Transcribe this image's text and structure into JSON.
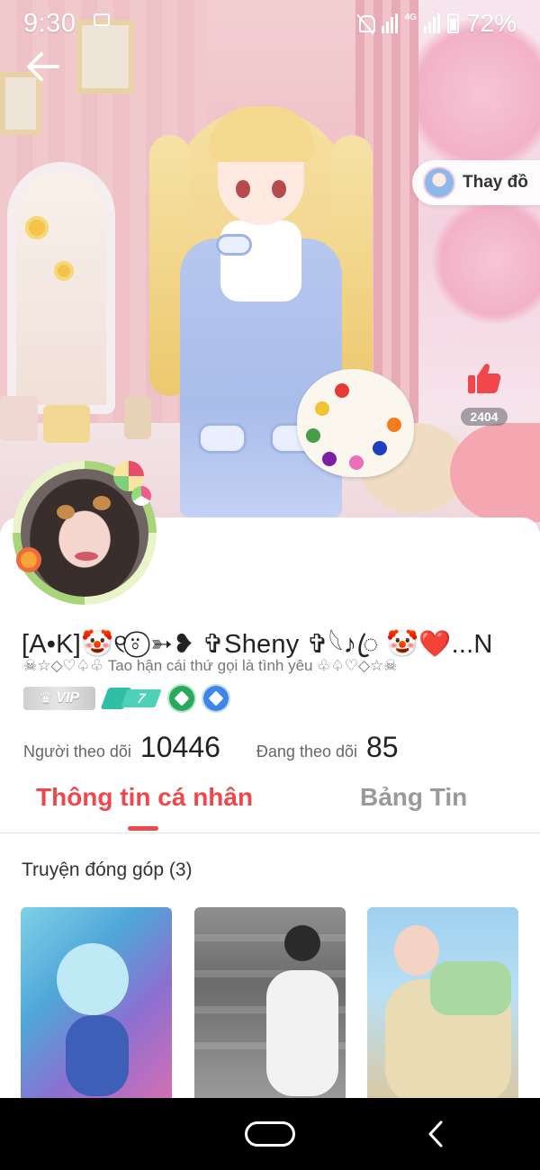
{
  "status_bar": {
    "time": "9:30",
    "battery_percent": "72%",
    "network": "4G"
  },
  "hero": {
    "change_outfit_label": "Thay đồ",
    "like_count": "2404"
  },
  "profile": {
    "nickname": "[A•K]🤡୧⍤⃝ ➳❥ ✞Sheny ✞𓆩♪ꦿ 🤡❤️...N",
    "signature": "☠☆◇♡♤♧ Tao hận cái thứ gọi là tình yêu ♧♤♡◇☆☠",
    "badges": {
      "vip_label": "VIP",
      "level": "7"
    },
    "followers_label": "Người theo dõi",
    "followers_count": "10446",
    "following_label": "Đang theo dõi",
    "following_count": "85"
  },
  "tabs": [
    {
      "label": "Thông tin cá nhân",
      "active": true
    },
    {
      "label": "Bảng Tin",
      "active": false
    }
  ],
  "section": {
    "title": "Truyện đóng góp (3)"
  },
  "colors": {
    "accent": "#f0474c",
    "like": "#f0474c",
    "tab_inactive": "#999999"
  },
  "icons": {
    "back": "back-arrow-icon",
    "like": "thumbs-up-icon",
    "nav_home": "home-pill-icon",
    "nav_back": "nav-back-icon"
  }
}
